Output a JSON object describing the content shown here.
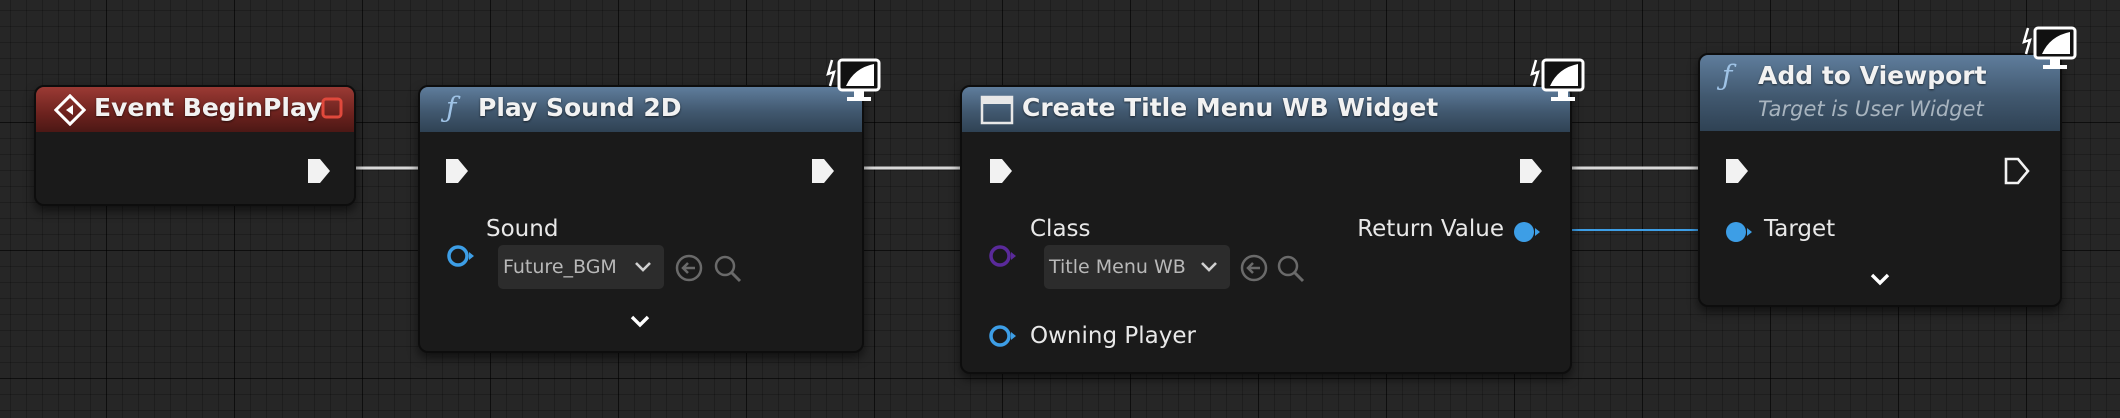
{
  "nodes": {
    "begin_play": {
      "title": "Event BeginPlay",
      "header_color": "#8a2c27"
    },
    "play_sound": {
      "title": "Play Sound 2D",
      "func_glyph": "ƒ",
      "sound_label": "Sound",
      "sound_value": "Future_BGM",
      "header_color": "#4a6480"
    },
    "create_widget": {
      "title": "Create Title Menu WB Widget",
      "class_label": "Class",
      "class_value": "Title Menu WB",
      "return_label": "Return Value",
      "owning_label": "Owning Player",
      "header_color": "#4a6480"
    },
    "add_viewport": {
      "title": "Add to Viewport",
      "subtitle": "Target is User Widget",
      "func_glyph": "ƒ",
      "target_label": "Target",
      "header_color": "#4a6480"
    }
  },
  "icons": [
    "event-diamond-icon",
    "breakpoint-square-icon",
    "function-icon",
    "widget-class-icon",
    "client-monitor-icon",
    "exec-pin-icon",
    "object-pin-icon",
    "use-selected-asset-icon",
    "browse-asset-icon",
    "dropdown-chevron-icon",
    "expand-chevron-icon"
  ],
  "colors": {
    "exec_wire": "#e8e8e8",
    "object_pin": "#3d9ee6",
    "class_pin": "#5a2a9a",
    "graph_bg": "#262626"
  }
}
